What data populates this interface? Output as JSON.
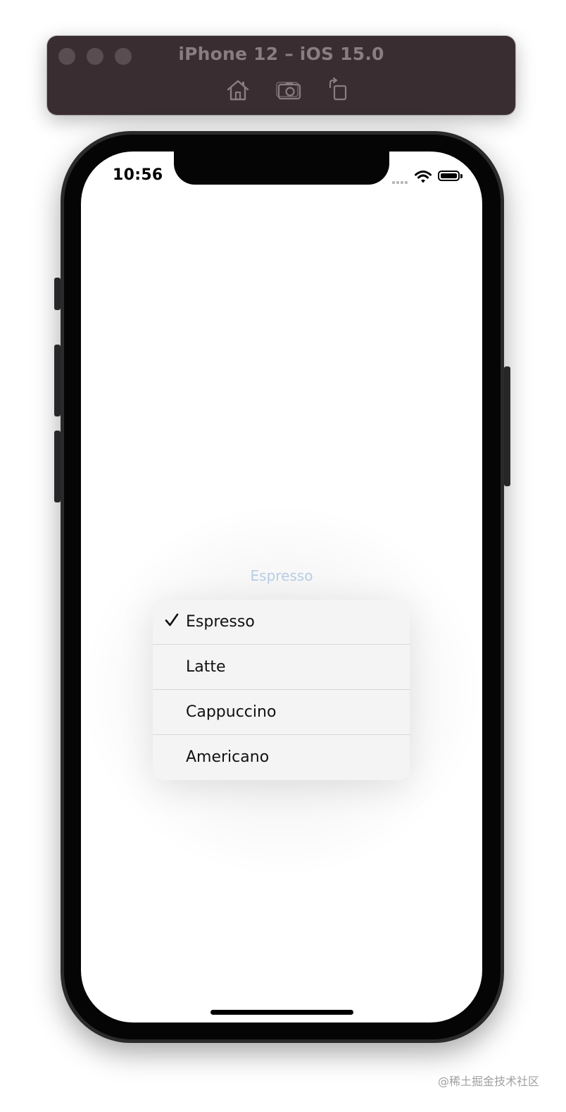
{
  "simulator": {
    "title": "iPhone 12 – iOS 15.0",
    "toolbar": [
      "home-icon",
      "screenshot-icon",
      "rotate-icon"
    ]
  },
  "status_bar": {
    "time": "10:56",
    "icons": [
      "cellular-signal-icon",
      "wifi-icon",
      "battery-icon"
    ]
  },
  "picker": {
    "selected_label": "Espresso",
    "accent_color": "#b8cde6"
  },
  "menu": {
    "items": [
      {
        "label": "Espresso",
        "checked": true
      },
      {
        "label": "Latte",
        "checked": false
      },
      {
        "label": "Cappuccino",
        "checked": false
      },
      {
        "label": "Americano",
        "checked": false
      }
    ]
  },
  "watermark": "@稀土掘金技术社区"
}
